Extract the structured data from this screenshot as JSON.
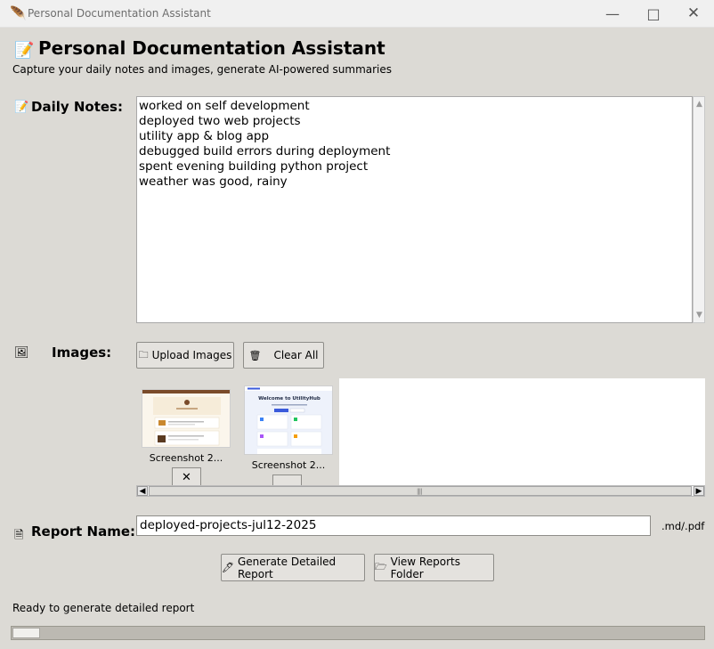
{
  "window": {
    "title": "Personal Documentation Assistant",
    "app_icon": "feather-icon",
    "controls": [
      "minimize",
      "maximize",
      "close"
    ]
  },
  "header": {
    "icon": "memo-icon",
    "title": "Personal Documentation Assistant",
    "subtitle": "Capture your daily notes and images, generate AI-powered summaries"
  },
  "notes": {
    "label": "Daily Notes:",
    "icon": "memo-icon",
    "lines": [
      "worked on self development",
      "deployed two web projects",
      "utility app & blog app",
      "debugged build errors during deployment",
      "spent evening building python project",
      "weather was good, rainy"
    ]
  },
  "images": {
    "label": "Images:",
    "icon": "photo-frame-icon",
    "upload_label": "Upload Images",
    "upload_icon": "folder-icon",
    "clear_label": "Clear All",
    "clear_icon": "trash-icon",
    "thumbnails": [
      {
        "caption": "Screenshot 2...",
        "remove_label": "✕"
      },
      {
        "caption": "Screenshot 2...",
        "remove_label": ""
      }
    ],
    "thumb2_heading": "Welcome to UtilityHub"
  },
  "report": {
    "label": "Report Name:",
    "icon": "document-icon",
    "value": "deployed-projects-jul12-2025",
    "extension": ".md/.pdf"
  },
  "actions": {
    "generate_label": "Generate Detailed Report",
    "generate_icon": "pen-icon",
    "view_label": "View Reports Folder",
    "view_icon": "open-folder-icon"
  },
  "status": {
    "text": "Ready to generate detailed report",
    "progress": 0.04
  }
}
